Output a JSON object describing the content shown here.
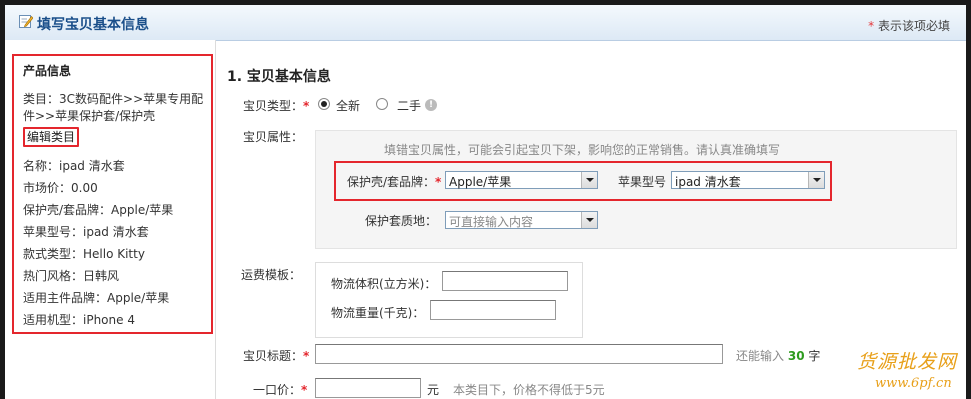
{
  "header": {
    "title": "填写宝贝基本信息",
    "required_note_star": "*",
    "required_note": "表示该项必填"
  },
  "product_info": {
    "title": "产品信息",
    "category_line1": "类目：3C数码配件>>苹果专用配",
    "category_line2": "件>>苹果保护套/保护壳",
    "edit_category": "编辑类目",
    "rows": [
      "名称：ipad 清水套",
      "市场价：0.00",
      "保护壳/套品牌：Apple/苹果",
      "苹果型号：ipad 清水套",
      "款式类型：Hello Kitty",
      "热门风格：日韩风",
      "适用主件品牌：Apple/苹果",
      "适用机型：iPhone 4"
    ]
  },
  "form": {
    "section_title": "1. 宝贝基本信息",
    "type_label": "宝贝类型：",
    "type_options": [
      "全新",
      "二手"
    ],
    "type_selected": "全新",
    "attr_label": "宝贝属性：",
    "attr_tip": "填错宝贝属性，可能会引起宝贝下架，影响您的正常销售。请认真准确填写",
    "brand_label": "保护壳/套品牌：",
    "brand_value": "Apple/苹果",
    "model_label": "苹果型号",
    "model_value": "ipad 清水套",
    "material_label": "保护套质地：",
    "material_placeholder": "可直接输入内容",
    "shipping_label": "运费模板：",
    "volume_label": "物流体积(立方米)：",
    "weight_label": "物流重量(千克)：",
    "title_label": "宝贝标题：",
    "title_remaining_pre": "还能输入",
    "title_remaining_num": "30",
    "title_remaining_post": "字",
    "price_label": "一口价：",
    "price_unit": "元",
    "price_hint": "本类目下，价格不得低于5元",
    "required_star": "*"
  },
  "watermark": {
    "line1": "货源批发网",
    "line2": "www.6pf.cn"
  },
  "colors": {
    "accent_red": "#e4262d",
    "header_blue": "#1b4f8a",
    "green": "#2e9b1f",
    "watermark": "#e8a01a"
  }
}
